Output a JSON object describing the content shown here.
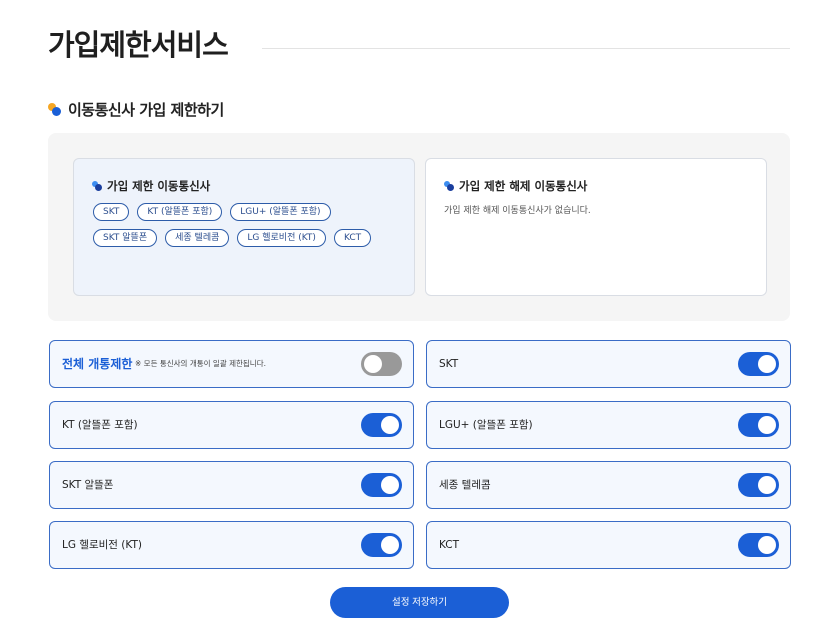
{
  "page": {
    "title": "가입제한서비스"
  },
  "section": {
    "heading": "이동통신사 가입 제한하기"
  },
  "restricted_card": {
    "title": "가입 제한 이동통신사",
    "carriers": [
      "SKT",
      "KT (알뜰폰 포함)",
      "LGU+ (알뜰폰 포함)",
      "SKT 알뜰폰",
      "세종 텔레콤",
      "LG 헬로비전 (KT)",
      "KCT"
    ]
  },
  "released_card": {
    "title": "가입 제한 해제 이동통신사",
    "empty_message": "가입 제한 해제 이동통신사가 없습니다."
  },
  "toggles": {
    "all": {
      "label": "전체 개통제한",
      "note": "※ 모든 통신사의 개통이 일괄 제한됩니다.",
      "on": false
    },
    "items": [
      {
        "label": "SKT",
        "on": true
      },
      {
        "label": "KT (알뜰폰 포함)",
        "on": true
      },
      {
        "label": "LGU+ (알뜰폰 포함)",
        "on": true
      },
      {
        "label": "SKT 알뜰폰",
        "on": true
      },
      {
        "label": "세종 텔레콤",
        "on": true
      },
      {
        "label": "LG 헬로비전 (KT)",
        "on": true
      },
      {
        "label": "KCT",
        "on": true
      }
    ]
  },
  "actions": {
    "save_label": "설정 저장하기"
  },
  "colors": {
    "accent": "#1b5fd6",
    "toggle_off": "#999999",
    "panel_bg": "#f5f5f5",
    "row_bg": "#f4f8fe"
  }
}
